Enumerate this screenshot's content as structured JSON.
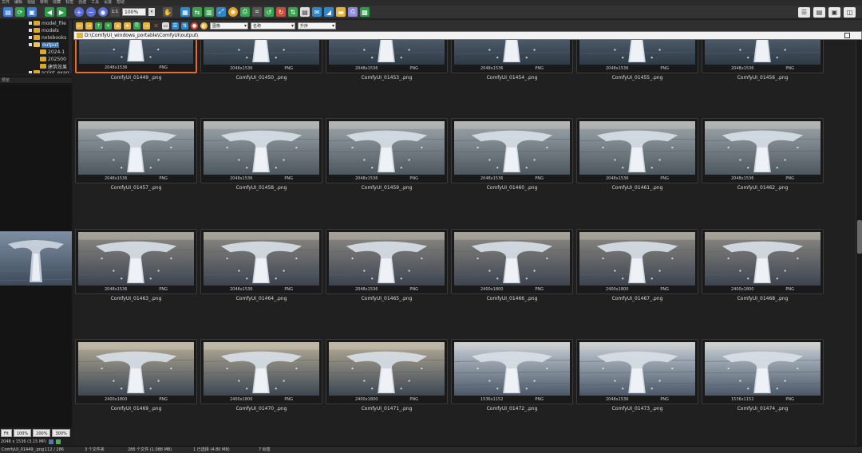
{
  "menu": [
    "文件",
    "编辑",
    "视图",
    "转到",
    "收藏",
    "标签",
    "创建",
    "工具",
    "设置",
    "帮助"
  ],
  "toolbar": {
    "zoom_value": "100%"
  },
  "filters": {
    "type_filter": "图像",
    "sort": "名称",
    "order": "升序"
  },
  "path": "D:\\ComfyUI_windows_portable\\ComfyUI\\output\\",
  "tree": {
    "items": [
      {
        "label": "model_file"
      },
      {
        "label": "models"
      },
      {
        "label": "notebooks"
      },
      {
        "label": "output"
      },
      {
        "label": "2024-1"
      },
      {
        "label": "202500"
      },
      {
        "label": "建筑效果"
      },
      {
        "label": "script_exam"
      }
    ]
  },
  "panel_label": "预览",
  "zoom_buttons": [
    "Fit",
    "100%",
    "200%",
    "300%"
  ],
  "left_info": "2048 x 1536 (3.15 MP)",
  "thumbnails": [
    {
      "name": "ComfyUI_01449_.png",
      "dims": "2048x1536",
      "format": "PNG"
    },
    {
      "name": "ComfyUI_01450_.png",
      "dims": "2048x1536",
      "format": "PNG"
    },
    {
      "name": "ComfyUI_01453_.png",
      "dims": "2048x1536",
      "format": "PNG"
    },
    {
      "name": "ComfyUI_01454_.png",
      "dims": "2048x1536",
      "format": "PNG"
    },
    {
      "name": "ComfyUI_01455_.png",
      "dims": "2048x1536",
      "format": "PNG"
    },
    {
      "name": "ComfyUI_01456_.png",
      "dims": "2048x1536",
      "format": "PNG"
    },
    {
      "name": "ComfyUI_01457_.png",
      "dims": "2048x1536",
      "format": "PNG"
    },
    {
      "name": "ComfyUI_01458_.png",
      "dims": "2048x1536",
      "format": "PNG"
    },
    {
      "name": "ComfyUI_01459_.png",
      "dims": "2048x1536",
      "format": "PNG"
    },
    {
      "name": "ComfyUI_01460_.png",
      "dims": "2048x1536",
      "format": "PNG"
    },
    {
      "name": "ComfyUI_01461_.png",
      "dims": "2048x1536",
      "format": "PNG"
    },
    {
      "name": "ComfyUI_01462_.png",
      "dims": "2048x1536",
      "format": "PNG"
    },
    {
      "name": "ComfyUI_01463_.png",
      "dims": "2048x1536",
      "format": "PNG"
    },
    {
      "name": "ComfyUI_01464_.png",
      "dims": "2048x1536",
      "format": "PNG"
    },
    {
      "name": "ComfyUI_01465_.png",
      "dims": "2048x1536",
      "format": "PNG"
    },
    {
      "name": "ComfyUI_01466_.png",
      "dims": "2400x1800",
      "format": "PNG"
    },
    {
      "name": "ComfyUI_01467_.png",
      "dims": "2400x1800",
      "format": "PNG"
    },
    {
      "name": "ComfyUI_01468_.png",
      "dims": "2400x1800",
      "format": "PNG"
    },
    {
      "name": "ComfyUI_01469_.png",
      "dims": "2400x1800",
      "format": "PNG"
    },
    {
      "name": "ComfyUI_01470_.png",
      "dims": "2400x1800",
      "format": "PNG"
    },
    {
      "name": "ComfyUI_01471_.png",
      "dims": "2400x1800",
      "format": "PNG"
    },
    {
      "name": "ComfyUI_01472_.png",
      "dims": "1536x1152",
      "format": "PNG"
    },
    {
      "name": "ComfyUI_01473_.png",
      "dims": "2048x1536",
      "format": "PNG"
    },
    {
      "name": "ComfyUI_01474_.png",
      "dims": "1536x1152",
      "format": "PNG"
    }
  ],
  "status": {
    "file": "ComfyUI_01449_.png",
    "position": "112 / 286",
    "selected": "3 个文件夹",
    "count": "286 个文件 (1.088 MB)",
    "chosen": "1 已选择 (4.80 MB)",
    "tags": "7 标签"
  },
  "colors": {
    "selection_border": "#e8692b",
    "background": "#202020"
  }
}
